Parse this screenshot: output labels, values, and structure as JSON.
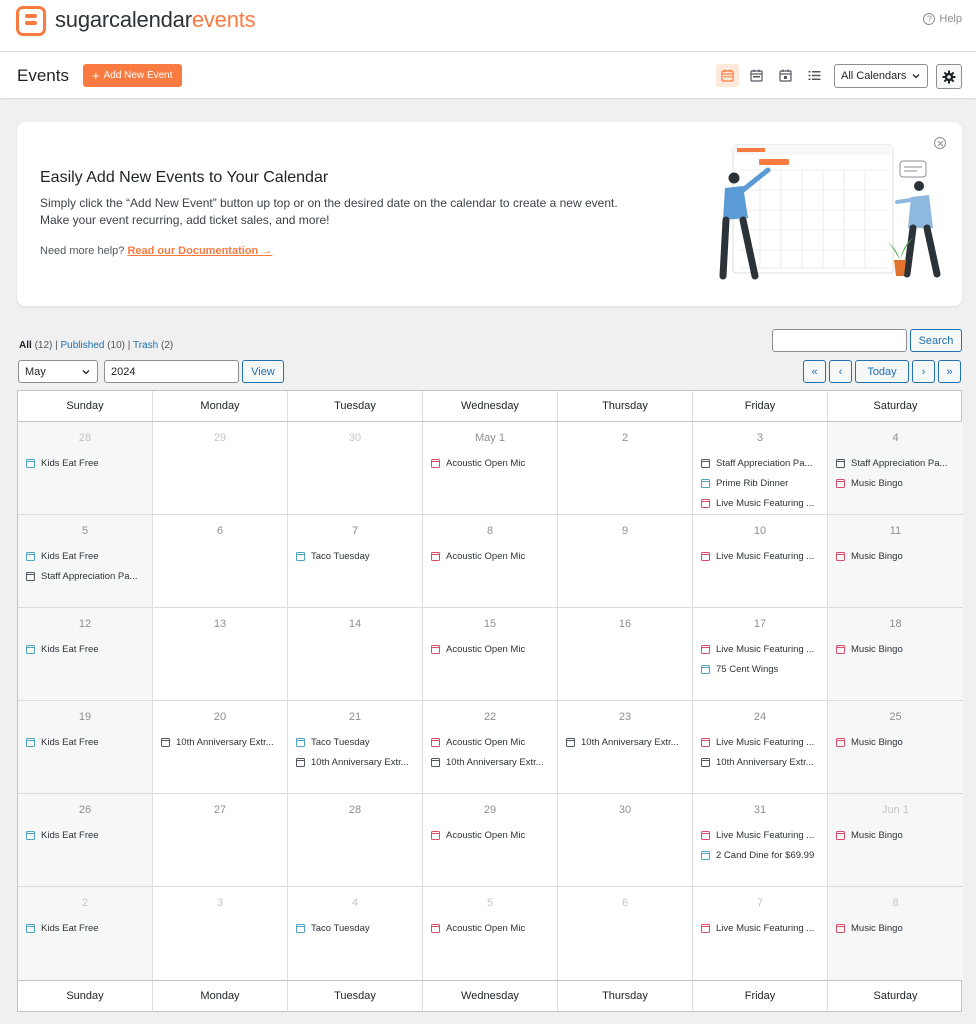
{
  "brand": {
    "part1": "sugarcalendar",
    "part2": "events"
  },
  "help_label": "Help",
  "header": {
    "title": "Events",
    "add_label": "Add New Event",
    "calendar_select": "All Calendars"
  },
  "promo": {
    "title": "Easily Add New Events to Your Calendar",
    "description": "Simply click the “Add New Event” button up top or on the desired date on the calendar to create a new event. Make your event recurring, add ticket sales, and more!",
    "help_prefix": "Need more help?",
    "doc_link": "Read our Documentation →"
  },
  "filters": {
    "all_label": "All",
    "all_count": "(12)",
    "published_label": "Published",
    "published_count": "(10)",
    "trash_label": "Trash",
    "trash_count": "(2)",
    "search_button": "Search",
    "month": "May",
    "year": "2024",
    "view_button": "View",
    "nav": {
      "first": "«",
      "prev": "‹",
      "today": "Today",
      "next": "›",
      "last": "»"
    }
  },
  "colors": {
    "accent": "#f97b42",
    "teal": "#4fa3bf",
    "red": "#d94d6a",
    "gray": "#50575e",
    "link": "#2271b1"
  },
  "calendar": {
    "days": [
      "Sunday",
      "Monday",
      "Tuesday",
      "Wednesday",
      "Thursday",
      "Friday",
      "Saturday"
    ],
    "weeks": [
      [
        {
          "d": "28",
          "other": true,
          "events": [
            {
              "t": "Kids Eat Free",
              "c": "teal"
            }
          ]
        },
        {
          "d": "29",
          "other": true,
          "events": []
        },
        {
          "d": "30",
          "other": true,
          "events": []
        },
        {
          "d": "May 1",
          "events": [
            {
              "t": "Acoustic Open Mic",
              "c": "red"
            }
          ]
        },
        {
          "d": "2",
          "events": []
        },
        {
          "d": "3",
          "events": [
            {
              "t": "Staff Appreciation Pa...",
              "c": "gray"
            },
            {
              "t": "Prime Rib Dinner",
              "c": "teal"
            },
            {
              "t": "Live Music Featuring ...",
              "c": "red"
            }
          ]
        },
        {
          "d": "4",
          "events": [
            {
              "t": "Staff Appreciation Pa...",
              "c": "gray"
            },
            {
              "t": "Music Bingo",
              "c": "red"
            }
          ]
        }
      ],
      [
        {
          "d": "5",
          "events": [
            {
              "t": "Kids Eat Free",
              "c": "teal"
            },
            {
              "t": "Staff Appreciation Pa...",
              "c": "gray"
            }
          ]
        },
        {
          "d": "6",
          "events": []
        },
        {
          "d": "7",
          "events": [
            {
              "t": "Taco Tuesday",
              "c": "teal"
            }
          ]
        },
        {
          "d": "8",
          "events": [
            {
              "t": "Acoustic Open Mic",
              "c": "red"
            }
          ]
        },
        {
          "d": "9",
          "events": []
        },
        {
          "d": "10",
          "events": [
            {
              "t": "Live Music Featuring ...",
              "c": "red"
            }
          ]
        },
        {
          "d": "11",
          "events": [
            {
              "t": "Music Bingo",
              "c": "red"
            }
          ]
        }
      ],
      [
        {
          "d": "12",
          "events": [
            {
              "t": "Kids Eat Free",
              "c": "teal"
            }
          ]
        },
        {
          "d": "13",
          "events": []
        },
        {
          "d": "14",
          "events": []
        },
        {
          "d": "15",
          "events": [
            {
              "t": "Acoustic Open Mic",
              "c": "red"
            }
          ]
        },
        {
          "d": "16",
          "events": []
        },
        {
          "d": "17",
          "events": [
            {
              "t": "Live Music Featuring ...",
              "c": "red"
            },
            {
              "t": "75 Cent Wings",
              "c": "teal"
            }
          ]
        },
        {
          "d": "18",
          "events": [
            {
              "t": "Music Bingo",
              "c": "red"
            }
          ]
        }
      ],
      [
        {
          "d": "19",
          "events": [
            {
              "t": "Kids Eat Free",
              "c": "teal"
            }
          ]
        },
        {
          "d": "20",
          "events": [
            {
              "t": "10th Anniversary Extr...",
              "c": "gray"
            }
          ]
        },
        {
          "d": "21",
          "events": [
            {
              "t": "Taco Tuesday",
              "c": "teal"
            },
            {
              "t": "10th Anniversary Extr...",
              "c": "gray"
            }
          ]
        },
        {
          "d": "22",
          "events": [
            {
              "t": "Acoustic Open Mic",
              "c": "red"
            },
            {
              "t": "10th Anniversary Extr...",
              "c": "gray"
            }
          ]
        },
        {
          "d": "23",
          "events": [
            {
              "t": "10th Anniversary Extr...",
              "c": "gray"
            }
          ]
        },
        {
          "d": "24",
          "events": [
            {
              "t": "Live Music Featuring ...",
              "c": "red"
            },
            {
              "t": "10th Anniversary Extr...",
              "c": "gray"
            }
          ]
        },
        {
          "d": "25",
          "events": [
            {
              "t": "Music Bingo",
              "c": "red"
            }
          ]
        }
      ],
      [
        {
          "d": "26",
          "events": [
            {
              "t": "Kids Eat Free",
              "c": "teal"
            }
          ]
        },
        {
          "d": "27",
          "events": []
        },
        {
          "d": "28",
          "events": []
        },
        {
          "d": "29",
          "events": [
            {
              "t": "Acoustic Open Mic",
              "c": "red"
            }
          ]
        },
        {
          "d": "30",
          "events": []
        },
        {
          "d": "31",
          "events": [
            {
              "t": "Live Music Featuring ...",
              "c": "red"
            },
            {
              "t": "2 Cand Dine for $69.99",
              "c": "teal"
            }
          ]
        },
        {
          "d": "Jun 1",
          "other": true,
          "events": [
            {
              "t": "Music Bingo",
              "c": "red"
            }
          ]
        }
      ],
      [
        {
          "d": "2",
          "other": true,
          "events": [
            {
              "t": "Kids Eat Free",
              "c": "teal"
            }
          ]
        },
        {
          "d": "3",
          "other": true,
          "events": []
        },
        {
          "d": "4",
          "other": true,
          "events": [
            {
              "t": "Taco Tuesday",
              "c": "teal"
            }
          ]
        },
        {
          "d": "5",
          "other": true,
          "events": [
            {
              "t": "Acoustic Open Mic",
              "c": "red"
            }
          ]
        },
        {
          "d": "6",
          "other": true,
          "events": []
        },
        {
          "d": "7",
          "other": true,
          "events": [
            {
              "t": "Live Music Featuring ...",
              "c": "red"
            }
          ]
        },
        {
          "d": "8",
          "other": true,
          "events": [
            {
              "t": "Music Bingo",
              "c": "red"
            }
          ]
        }
      ]
    ]
  }
}
